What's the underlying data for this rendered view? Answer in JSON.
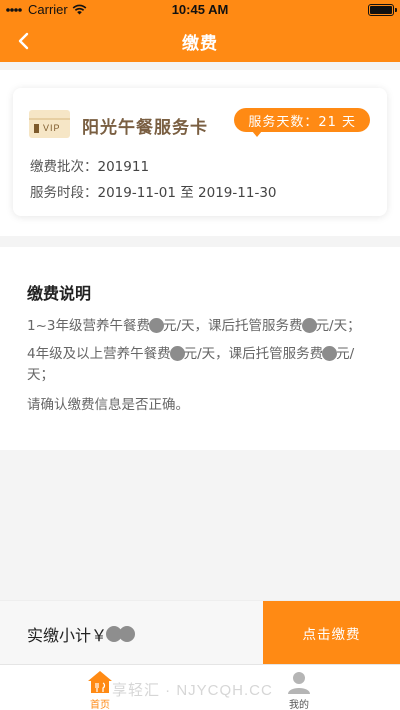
{
  "status_bar": {
    "carrier": "Carrier",
    "time": "10:45 AM"
  },
  "nav": {
    "title": "缴费",
    "back_icon": "chevron-left-icon"
  },
  "card": {
    "icon_text": "VIP",
    "title": "阳光午餐服务卡",
    "days_badge": "服务天数：21 天",
    "batch_label": "缴费批次：",
    "batch_value": "201911",
    "period_label": "服务时段：",
    "period_value": "2019-11-01 至 2019-11-30"
  },
  "explain": {
    "title": "缴费说明",
    "line1_a": "1~3年级营养午餐费",
    "line1_b": "元/天，课后托管服务费",
    "line1_c": "元/天；",
    "line2_a": "4年级及以上营养午餐费",
    "line2_b": "元/天，课后托管服务费",
    "line2_c": "元/天；",
    "line3": "请确认缴费信息是否正确。"
  },
  "pay_bar": {
    "subtotal_label": "实缴小计￥",
    "pay_button": "点击缴费"
  },
  "tabs": [
    {
      "label": "首页",
      "icon": "home-icon",
      "active": true
    },
    {
      "label": "我的",
      "icon": "user-icon",
      "active": false
    }
  ],
  "watermark": "享轻汇 · NJYCQH.CC",
  "colors": {
    "accent": "#ff8a14",
    "card_title": "#7a5f42"
  }
}
